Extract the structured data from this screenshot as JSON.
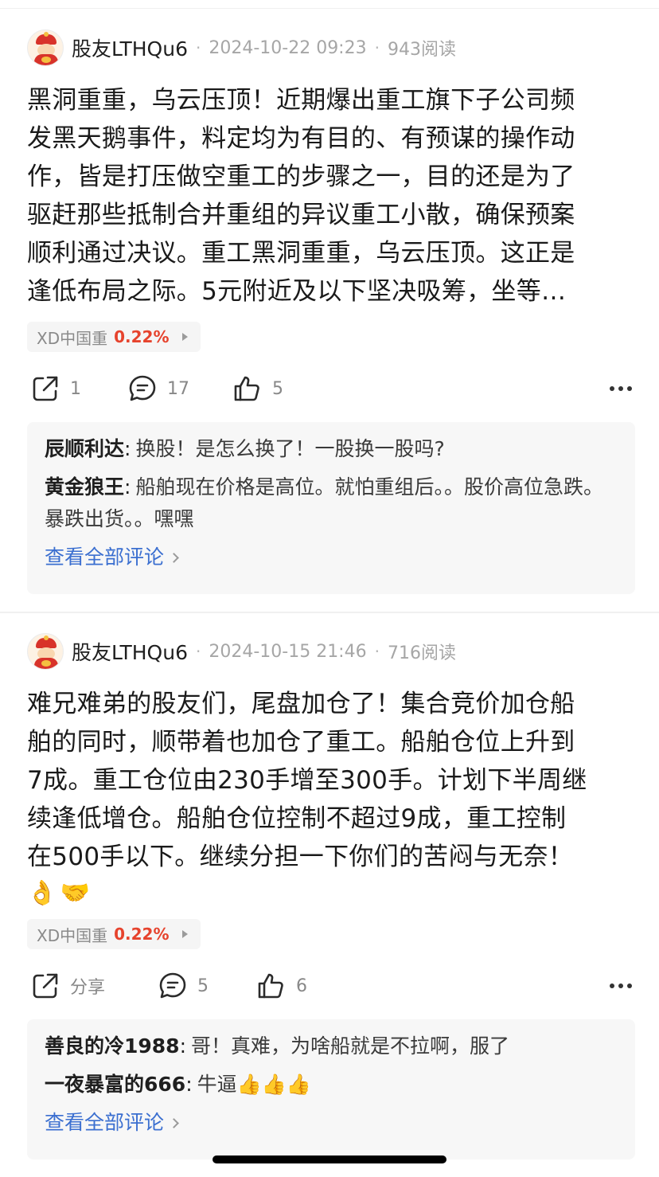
{
  "posts": [
    {
      "username": "股友LTHQu6",
      "timestamp": "2024-10-22 09:23",
      "reads": "943阅读",
      "content_lines": [
        "黑洞重重，乌云压顶！近期爆出重工旗下子公司频",
        "发黑天鹅事件，料定均为有目的、有预谋的操作动",
        "作，皆是打压做空重工的步骤之一，目的还是为了",
        "驱赶那些抵制合并重组的异议重工小散，确保预案",
        "顺利通过决议。重工黑洞重重，乌云压顶。这正是",
        "逢低布局之际。5元附近及以下坚决吸筹，坐等…"
      ],
      "stock": {
        "name": "XD中国重",
        "change": "0.22%"
      },
      "actions": {
        "share": "1",
        "comments": "17",
        "likes": "5"
      },
      "comments": [
        {
          "author": "辰顺利达",
          "text": "换股！是怎么换了！一股换一股吗?"
        },
        {
          "author": "黄金狼王",
          "text": "船舶现在价格是高位。就怕重组后。。股价高位急跌。暴跌出货。。嘿嘿"
        }
      ],
      "view_all": "查看全部评论"
    },
    {
      "username": "股友LTHQu6",
      "timestamp": "2024-10-15 21:46",
      "reads": "716阅读",
      "content_lines": [
        "难兄难弟的股友们，尾盘加仓了！集合竞价加仓船",
        "舶的同时，顺带着也加仓了重工。船舶仓位上升到",
        "7成。重工仓位由230手增至300手。计划下半周继",
        "续逢低增仓。船舶仓位控制不超过9成，重工控制",
        "在500手以下。继续分担一下你们的苦闷与无奈！"
      ],
      "emojis": [
        "👌",
        "🤝"
      ],
      "stock": {
        "name": "XD中国重",
        "change": "0.22%"
      },
      "actions": {
        "share": "分享",
        "comments": "5",
        "likes": "6"
      },
      "comments": [
        {
          "author": "善良的冷1988",
          "text": "哥！真难，为啥船就是不拉啊，服了"
        },
        {
          "author": "一夜暴富的666",
          "text": "牛逼👍👍👍"
        }
      ],
      "view_all": "查看全部评论"
    }
  ],
  "colors": {
    "accent_red": "#e6432d",
    "link_blue": "#3b6fd0",
    "meta_gray": "#a6a6a6"
  }
}
